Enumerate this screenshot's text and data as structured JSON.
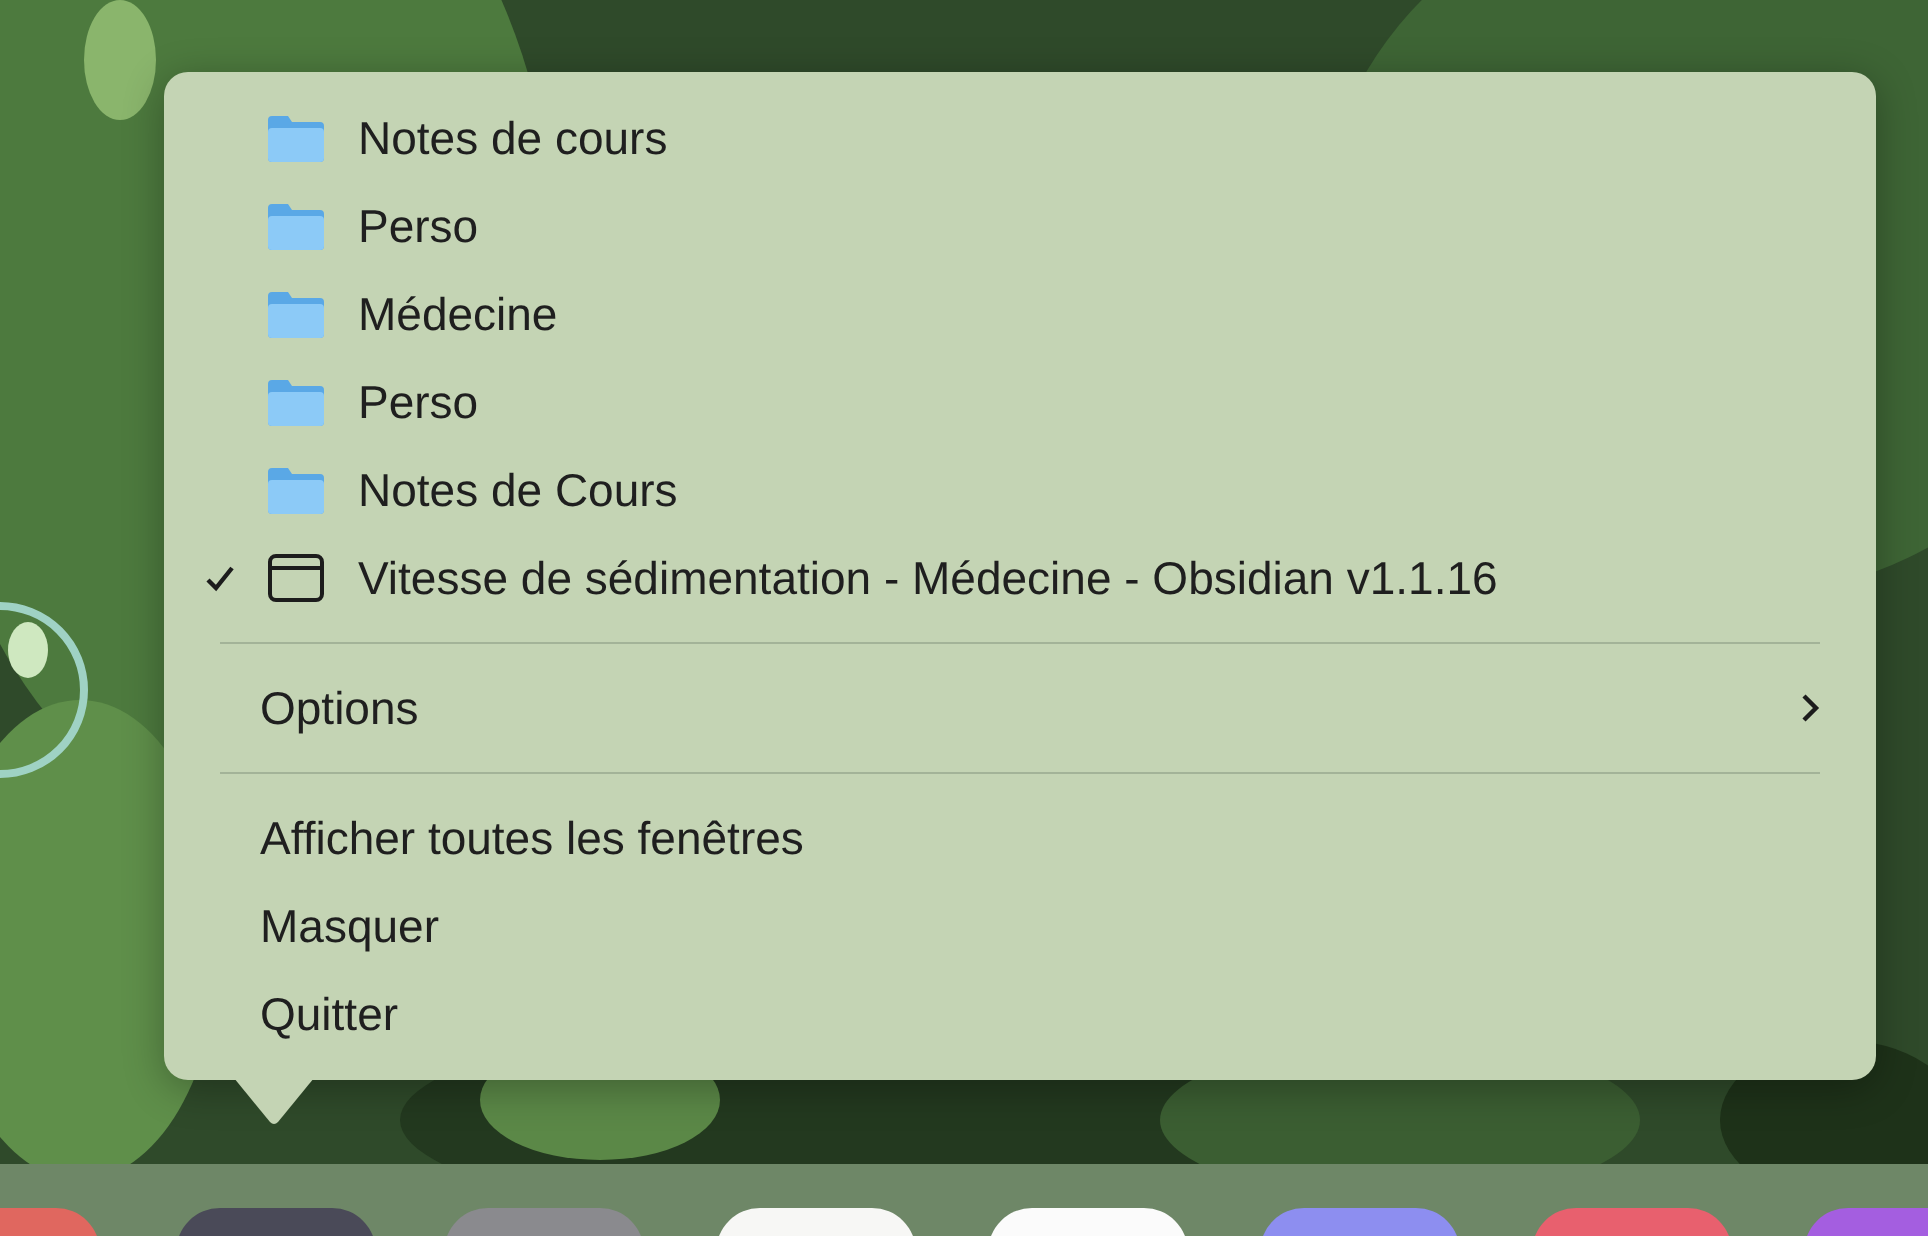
{
  "menu": {
    "windows": [
      {
        "kind": "folder",
        "label": "Notes de cours",
        "checked": false
      },
      {
        "kind": "folder",
        "label": "Perso",
        "checked": false
      },
      {
        "kind": "folder",
        "label": "Médecine",
        "checked": false
      },
      {
        "kind": "folder",
        "label": "Perso",
        "checked": false
      },
      {
        "kind": "folder",
        "label": "Notes de Cours",
        "checked": false
      },
      {
        "kind": "window",
        "label": "Vitesse de sédimentation - Médecine - Obsidian v1.1.16",
        "checked": true
      }
    ],
    "submenus": [
      {
        "label": "Options"
      }
    ],
    "actions": [
      {
        "label": "Afficher toutes les fenêtres"
      },
      {
        "label": "Masquer"
      },
      {
        "label": "Quitter"
      }
    ]
  }
}
